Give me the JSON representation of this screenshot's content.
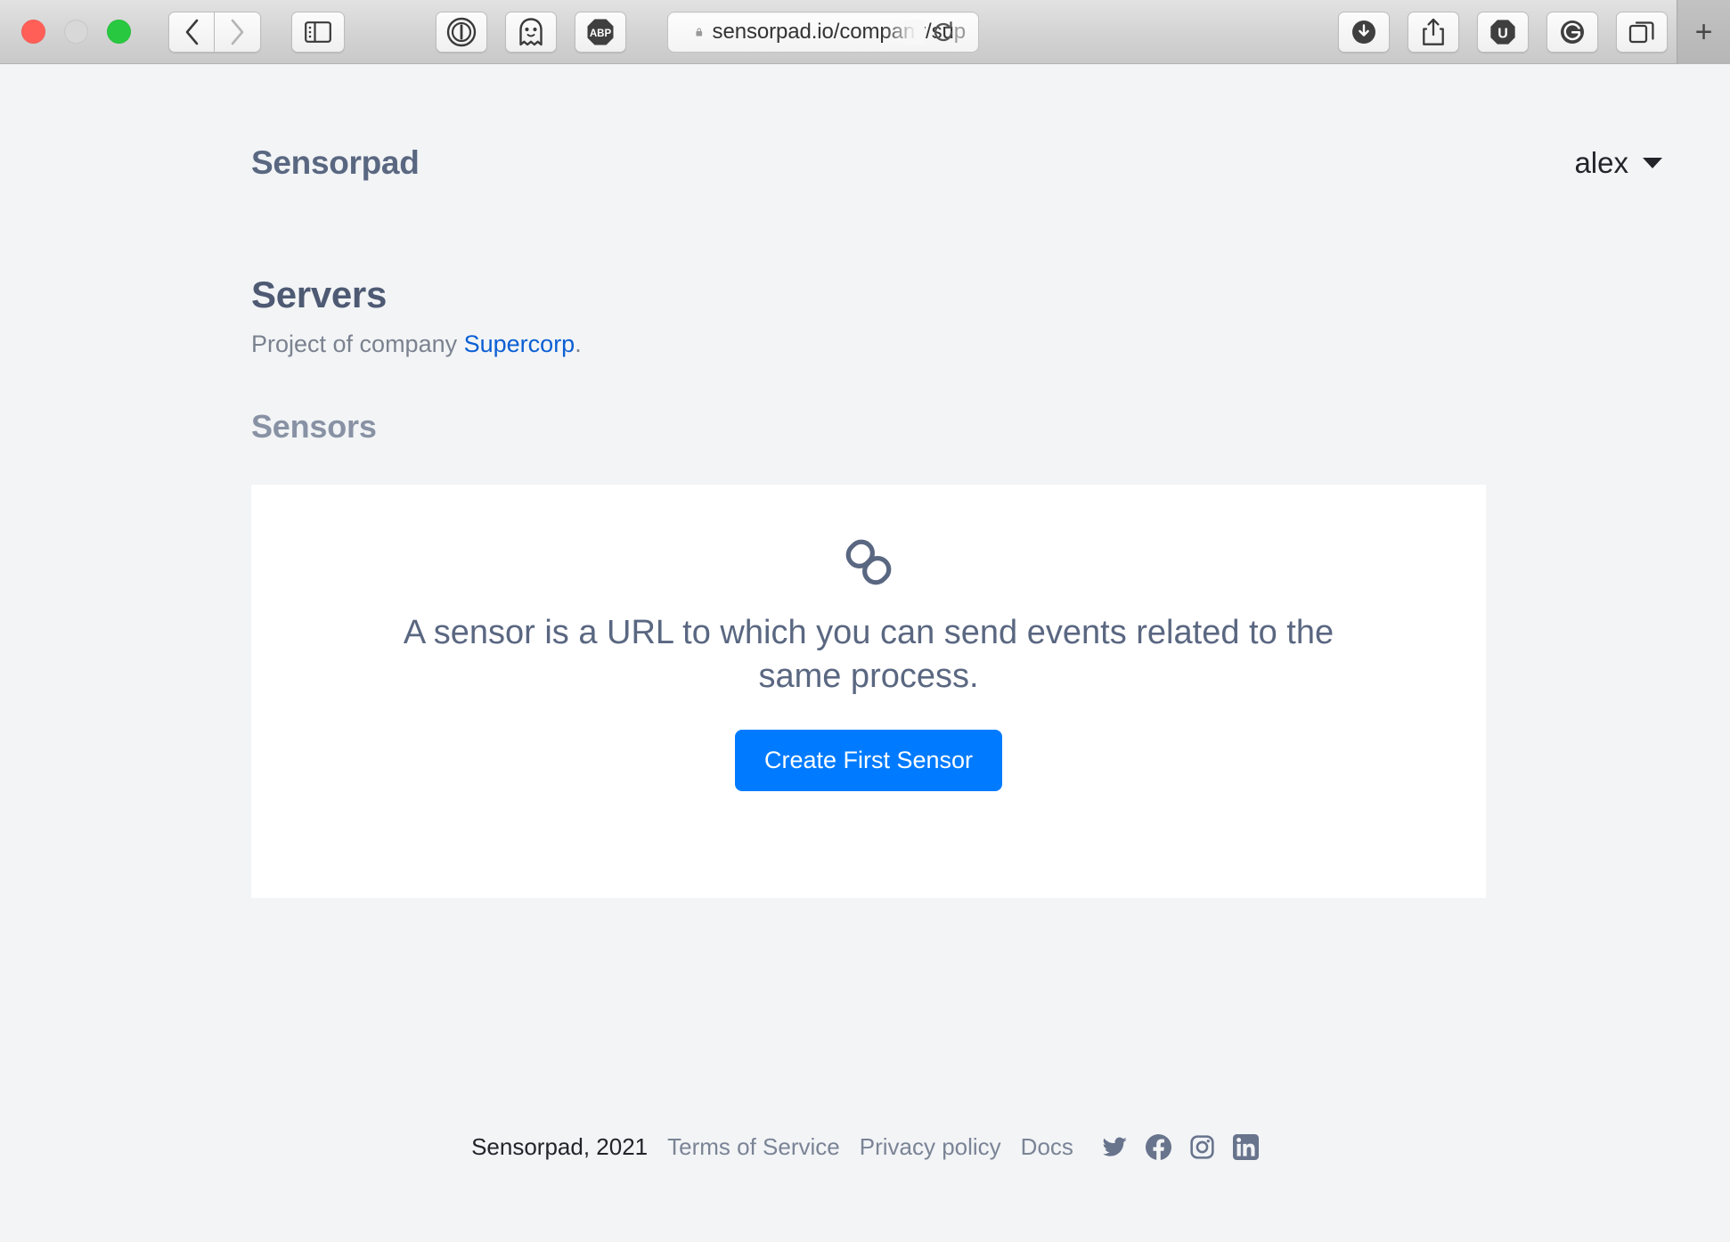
{
  "browser": {
    "window_controls": [
      "close",
      "minimize",
      "zoom"
    ],
    "back_label": "‹",
    "forward_label": "›",
    "sidebar_icon": "sidebar-icon",
    "extensions": [
      "1password-icon",
      "ghostery-icon",
      "adblock-plus-icon"
    ],
    "url": {
      "lock_icon": "lock-icon",
      "visible_text": "sensorpad.io/company/su",
      "truncated_text": "p",
      "reload_icon": "reload-icon"
    },
    "right_tools": [
      "downloads-icon",
      "share-icon",
      "ublock-icon",
      "grammarly-icon",
      "tab-overview-icon"
    ],
    "new_tab_label": "+"
  },
  "header": {
    "brand": "Sensorpad",
    "user": "alex"
  },
  "main": {
    "title": "Servers",
    "subtitle_prefix": "Project of company ",
    "subtitle_link": "Supercorp",
    "subtitle_suffix": ".",
    "section_title": "Sensors",
    "empty_state": {
      "icon": "link-icon",
      "message": "A sensor is a URL to which you can send events related to the same process.",
      "cta_label": "Create First Sensor",
      "cta_color": "#007bff"
    }
  },
  "footer": {
    "copyright": "Sensorpad, 2021",
    "links": [
      {
        "label": "Terms of Service"
      },
      {
        "label": "Privacy policy"
      },
      {
        "label": "Docs"
      }
    ],
    "social": [
      "twitter-icon",
      "facebook-icon",
      "instagram-icon",
      "linkedin-icon"
    ]
  }
}
